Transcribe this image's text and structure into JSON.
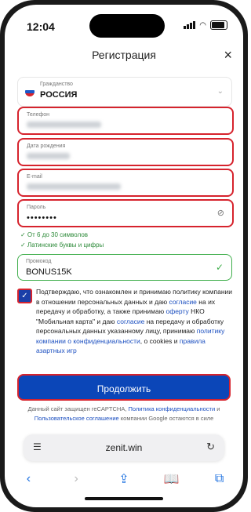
{
  "status": {
    "time": "12:04"
  },
  "header": {
    "title": "Регистрация",
    "close": "×"
  },
  "citizenship": {
    "label": "Гражданство",
    "value": "РОССИЯ"
  },
  "phone": {
    "label": "Телефон"
  },
  "birthdate": {
    "label": "Дата рождения"
  },
  "email": {
    "label": "E-mail"
  },
  "password": {
    "label": "Пароль",
    "value": "••••••••",
    "eye_icon": "eye-off-icon"
  },
  "password_hints": [
    "✓ От 6 до 30 символов",
    "✓ Латинские буквы и цифры"
  ],
  "promo": {
    "label": "Промокод",
    "value": "BONUS15K",
    "check_icon": "✓"
  },
  "consent": {
    "p1": "Подтверждаю, что ознакомлен и принимаю политику компании в отношении персональных данных и даю ",
    "link1": "согласие",
    "p2": " на их передачу и обработку, а также принимаю ",
    "link2": "оферту",
    "p3": " НКО \"Мобильная карта\" и даю ",
    "link3": "согласие",
    "p4": " на передачу и обработку персональных данных указанному лицу, принимаю ",
    "link4": "политику компании о конфиденциальности",
    "p5": ", о cookies и ",
    "link5": "правила азартных игр"
  },
  "submit": {
    "label": "Продолжить"
  },
  "captcha": {
    "t1": "Данный сайт защищен reCAPTCHA, ",
    "link1": "Политика конфиденциальности",
    "t2": " и ",
    "link2": "Пользовательское соглашение",
    "t3": " компании Google остаются в силе"
  },
  "browser": {
    "url": "zenit.win"
  },
  "colors": {
    "accent_red": "#d6232d",
    "button_blue": "#0b46b8",
    "success_green": "#3fae4b"
  }
}
